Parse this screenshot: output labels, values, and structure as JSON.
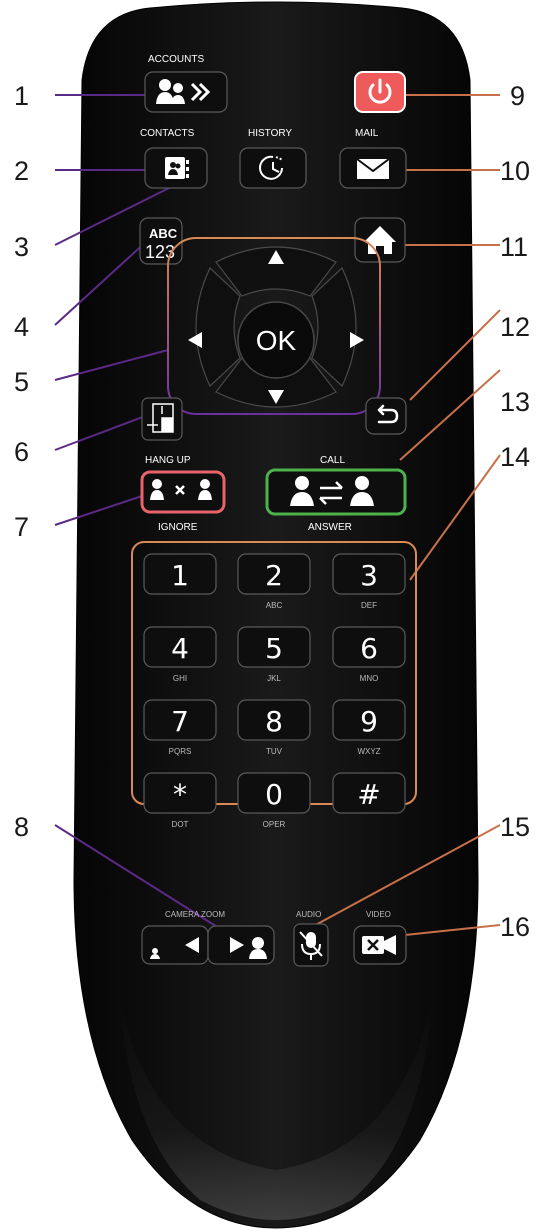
{
  "callouts": [
    {
      "id": "1",
      "name": "accounts"
    },
    {
      "id": "2",
      "name": "contacts"
    },
    {
      "id": "3",
      "name": "history"
    },
    {
      "id": "4",
      "name": "abc-123"
    },
    {
      "id": "5",
      "name": "dpad"
    },
    {
      "id": "6",
      "name": "layout"
    },
    {
      "id": "7",
      "name": "hangup"
    },
    {
      "id": "8",
      "name": "camera-zoom"
    },
    {
      "id": "9",
      "name": "power"
    },
    {
      "id": "10",
      "name": "mail"
    },
    {
      "id": "11",
      "name": "home"
    },
    {
      "id": "12",
      "name": "back"
    },
    {
      "id": "13",
      "name": "call"
    },
    {
      "id": "14",
      "name": "keypad"
    },
    {
      "id": "15",
      "name": "audio"
    },
    {
      "id": "16",
      "name": "video"
    }
  ],
  "labels": {
    "accounts": "ACCOUNTS",
    "contacts": "CONTACTS",
    "history": "HISTORY",
    "mail": "MAIL",
    "abc": "ABC",
    "n123": "123",
    "ok": "OK",
    "hang_up": "HANG UP",
    "ignore": "IGNORE",
    "call": "CALL",
    "answer": "ANSWER",
    "camera_zoom": "CAMERA ZOOM",
    "audio": "AUDIO",
    "video": "VIDEO"
  },
  "keypad": [
    {
      "key": "1",
      "sub": ""
    },
    {
      "key": "2",
      "sub": "ABC"
    },
    {
      "key": "3",
      "sub": "DEF"
    },
    {
      "key": "4",
      "sub": "GHI"
    },
    {
      "key": "5",
      "sub": "JKL"
    },
    {
      "key": "6",
      "sub": "MNO"
    },
    {
      "key": "7",
      "sub": "PQRS"
    },
    {
      "key": "8",
      "sub": "TUV"
    },
    {
      "key": "9",
      "sub": "WXYZ"
    },
    {
      "key": "*",
      "sub": "DOT"
    },
    {
      "key": "0",
      "sub": "OPER"
    },
    {
      "key": "#",
      "sub": ""
    }
  ],
  "colors": {
    "remote_body": "#0b0b0b",
    "callout_line_left": "#5b2a86",
    "callout_line_right": "#c8704a",
    "hangup_ring": "#e8636a",
    "call_ring": "#4cb34c",
    "power_button": "#ef5a5a",
    "keypad_outline": "#d98a55",
    "dpad_outline_top": "#d98a55",
    "dpad_outline_bottom": "#6a2fa0"
  },
  "icons": [
    "accounts-icon",
    "contacts-icon",
    "history-icon",
    "mail-icon",
    "power-icon",
    "home-icon",
    "back-icon",
    "layout-icon",
    "hangup-icon",
    "call-icon",
    "zoom-out-icon",
    "zoom-in-icon",
    "mute-icon",
    "video-off-icon"
  ]
}
